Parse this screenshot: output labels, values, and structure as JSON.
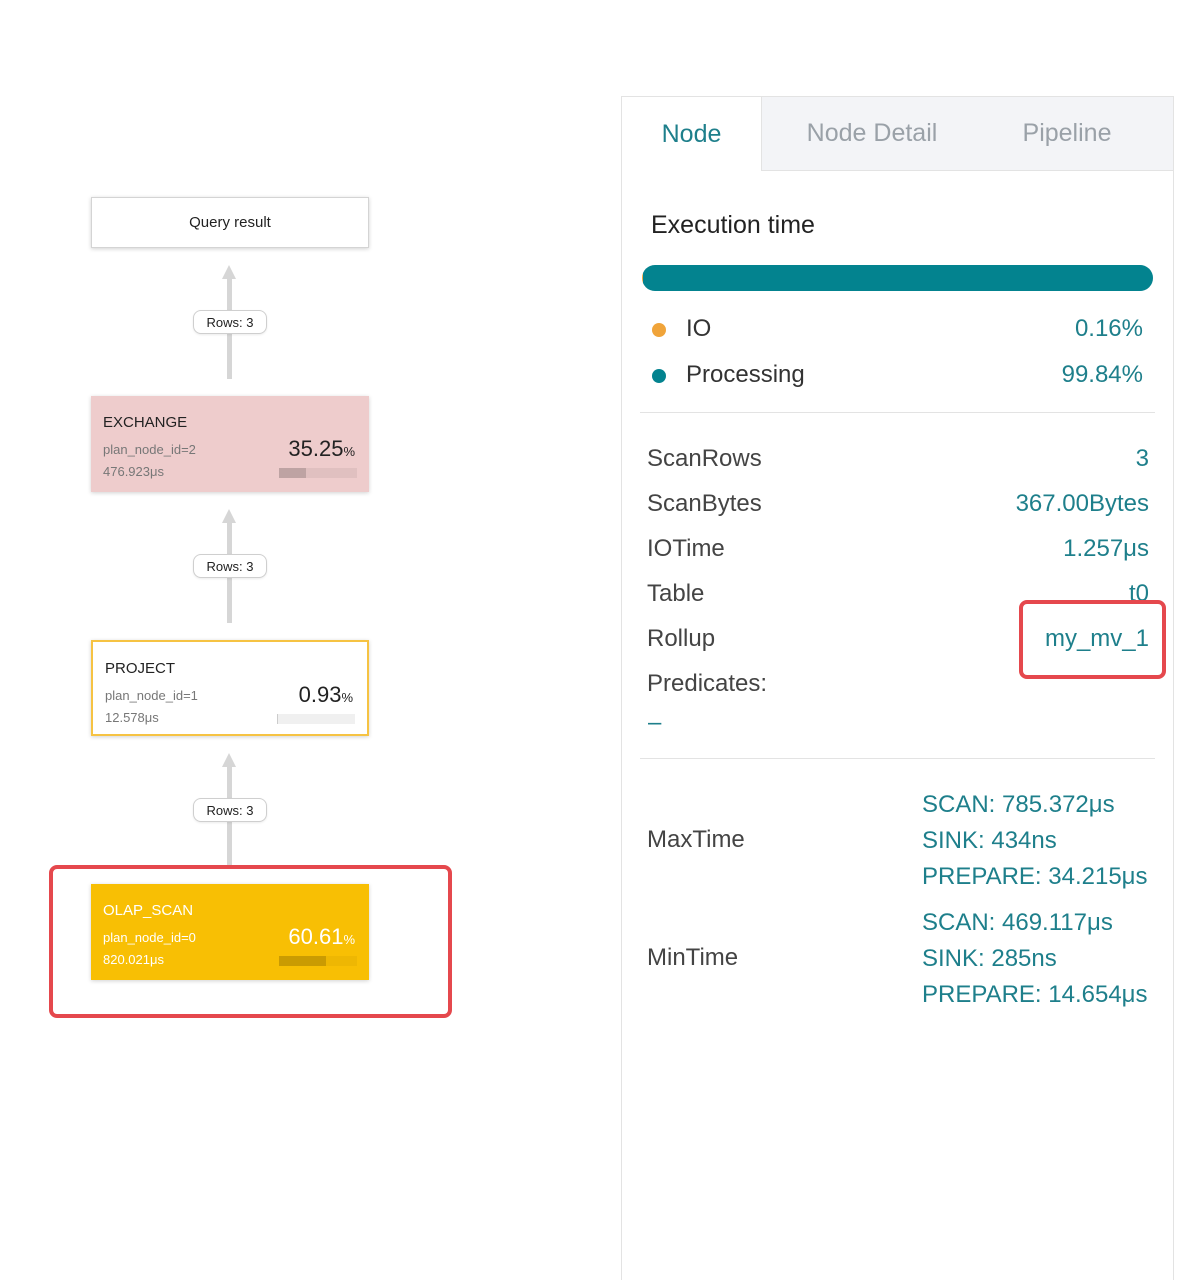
{
  "graph": {
    "query_result": "Query result",
    "edges": [
      {
        "label": "Rows: 3"
      },
      {
        "label": "Rows: 3"
      },
      {
        "label": "Rows: 3"
      }
    ],
    "nodes": [
      {
        "name": "EXCHANGE",
        "plan_node_id": "plan_node_id=2",
        "time": "476.923μs",
        "percent": "35.25",
        "percent_unit": "%",
        "fraction": 0.3525
      },
      {
        "name": "PROJECT",
        "plan_node_id": "plan_node_id=1",
        "time": "12.578μs",
        "percent": "0.93",
        "percent_unit": "%",
        "fraction": 0.0093
      },
      {
        "name": "OLAP_SCAN",
        "plan_node_id": "plan_node_id=0",
        "time": "820.021μs",
        "percent": "60.61",
        "percent_unit": "%",
        "fraction": 0.6061
      }
    ]
  },
  "panel": {
    "tabs": [
      "Node",
      "Node Detail",
      "Pipeline"
    ],
    "active_tab": "Node",
    "execution": {
      "title": "Execution time",
      "io_fraction": 0.0016,
      "processing_fraction": 0.9984,
      "io_label": "IO",
      "io_value": "0.16%",
      "processing_label": "Processing",
      "processing_value": "99.84%"
    },
    "stats": [
      {
        "key": "ScanRows",
        "value": "3"
      },
      {
        "key": "ScanBytes",
        "value": "367.00Bytes"
      },
      {
        "key": "IOTime",
        "value": "1.257μs"
      },
      {
        "key": "Table",
        "value": "t0"
      },
      {
        "key": "Rollup",
        "value": "my_mv_1"
      },
      {
        "key": "Predicates:",
        "value": ""
      }
    ],
    "predicates_value": "–",
    "max_time": {
      "label": "MaxTime",
      "lines": [
        "SCAN: 785.372μs",
        "SINK: 434ns",
        "PREPARE: 34.215μs"
      ]
    },
    "min_time": {
      "label": "MinTime",
      "lines": [
        "SCAN: 469.117μs",
        "SINK: 285ns",
        "PREPARE: 14.654μs"
      ]
    }
  },
  "colors": {
    "accent": "#1e7f8b",
    "processing": "#03838f",
    "io": "#f0a43a",
    "exchange_bg": "#eecccc",
    "project_border": "#f6c343",
    "olap_bg": "#f8bf04",
    "highlight": "#e5484d"
  }
}
